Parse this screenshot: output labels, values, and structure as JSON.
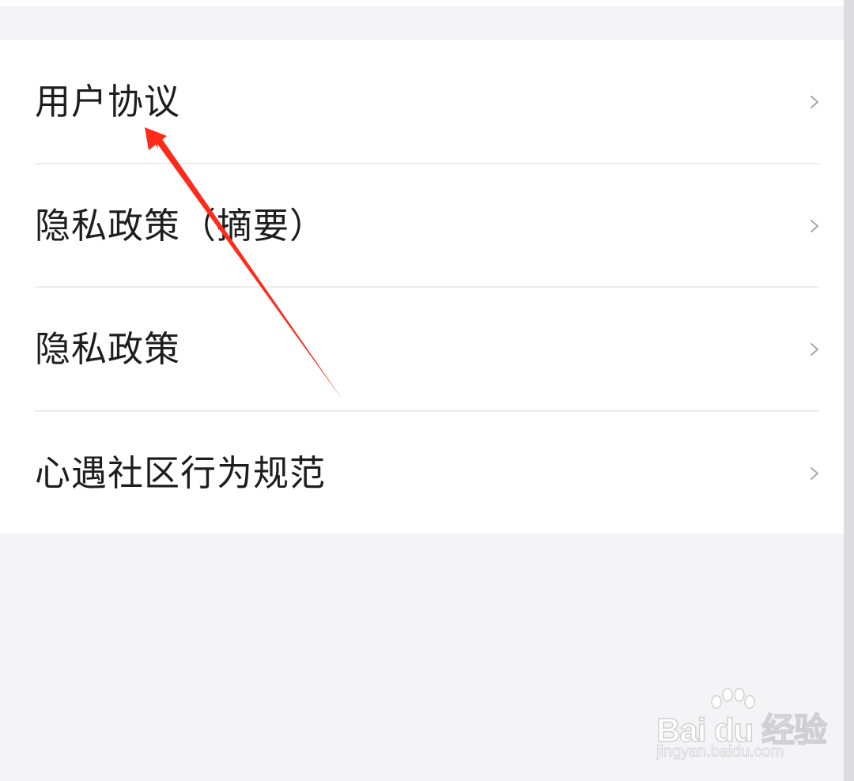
{
  "menu": {
    "items": [
      {
        "label": "用户协议"
      },
      {
        "label": "隐私政策（摘要）"
      },
      {
        "label": "隐私政策"
      },
      {
        "label": "心遇社区行为规范"
      }
    ]
  },
  "icons": {
    "chevron": "chevron-right-icon"
  },
  "colors": {
    "page_background": "#f4f4f6",
    "list_background": "#ffffff",
    "text": "#1e1e1e",
    "chevron": "#a8a8a8",
    "annotation_arrow": "#ff2a1a"
  },
  "watermark": {
    "logo_text": "Bai du 经验",
    "url": "jingyan.baidu.com"
  }
}
